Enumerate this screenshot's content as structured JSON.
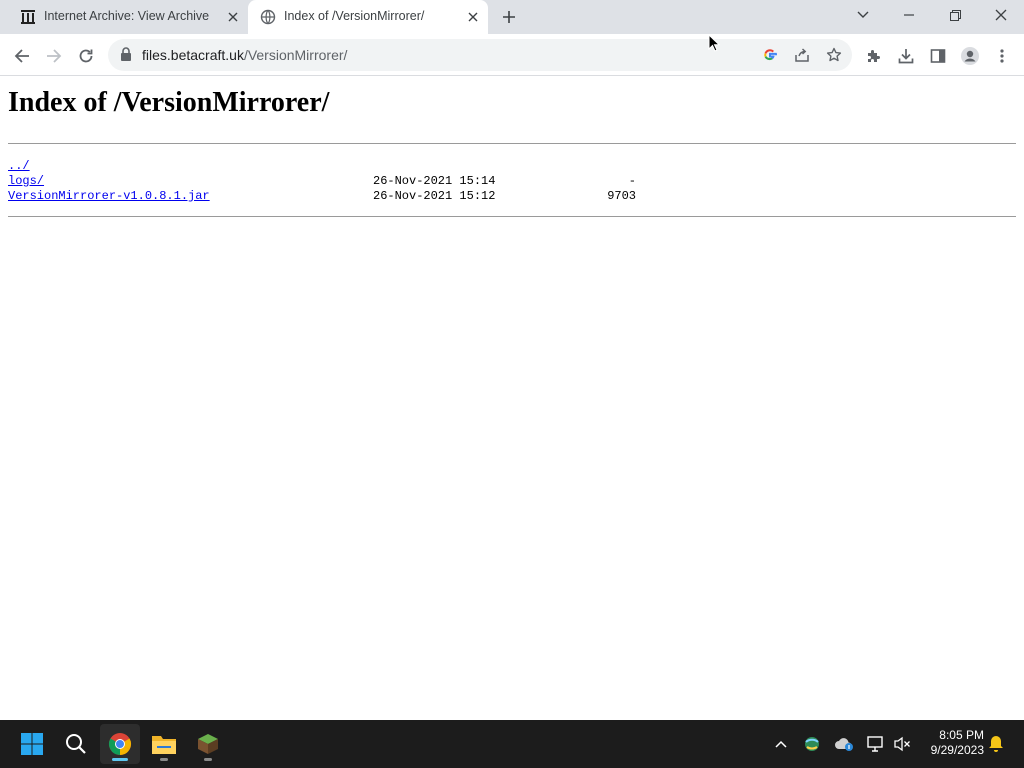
{
  "browser": {
    "tabs": [
      {
        "title": "Internet Archive: View Archive",
        "favicon": "archive-building-icon",
        "active": false
      },
      {
        "title": "Index of /VersionMirrorer/",
        "favicon": "globe-icon",
        "active": true
      }
    ],
    "url": {
      "host": "files.betacraft.uk",
      "path": "/VersionMirrorer/"
    }
  },
  "page": {
    "heading": "Index of /VersionMirrorer/",
    "entries": [
      {
        "name": "../",
        "date": "",
        "size": ""
      },
      {
        "name": "logs/",
        "date": "26-Nov-2021 15:14",
        "size": "-"
      },
      {
        "name": "VersionMirrorer-v1.0.8.1.jar",
        "date": "26-Nov-2021 15:12",
        "size": "9703"
      }
    ]
  },
  "taskbar": {
    "time": "8:05 PM",
    "date": "9/29/2023",
    "apps": [
      "start-icon",
      "search-icon",
      "chrome-icon",
      "file-explorer-icon",
      "minecraft-icon"
    ]
  },
  "colors": {
    "link": "#0000ee",
    "tabstrip": "#dee1e6",
    "omnibox": "#f1f3f4",
    "taskbar": "#1c1c1c"
  }
}
